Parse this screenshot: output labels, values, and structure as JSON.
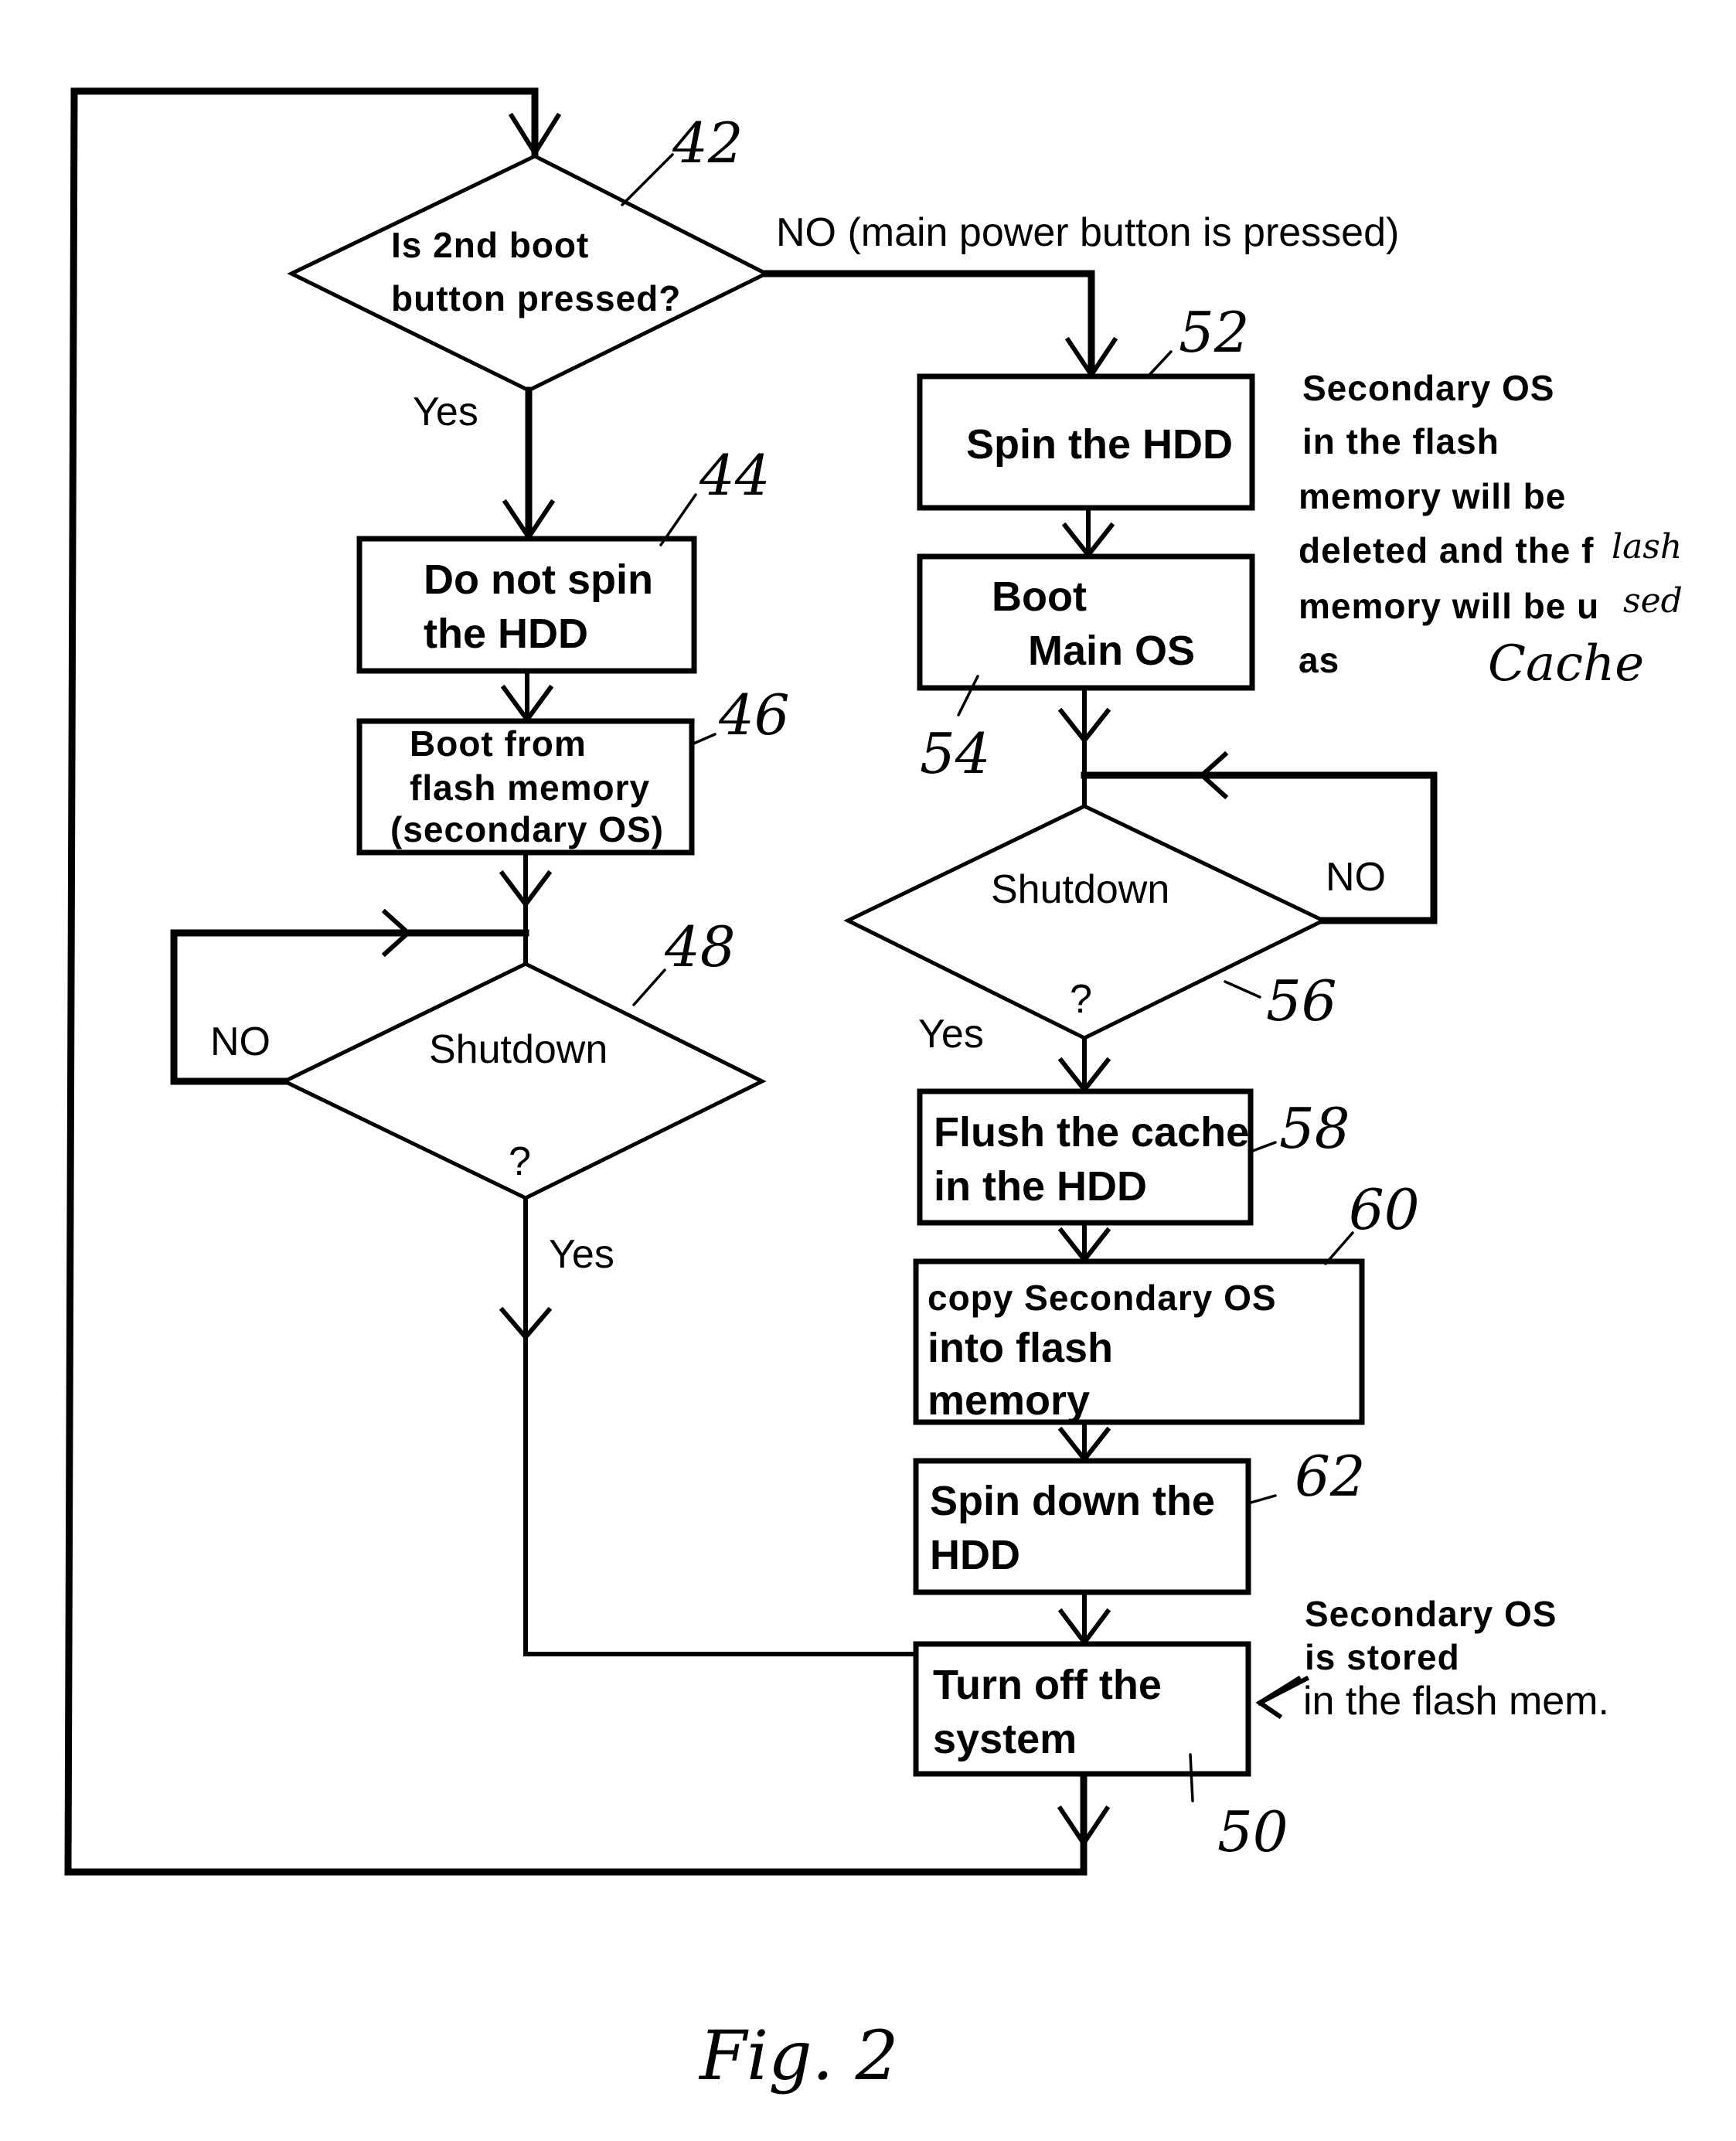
{
  "figure": {
    "caption": "Fig. 2"
  },
  "nodes": {
    "n42": {
      "ref": "42",
      "type": "decision",
      "lines": [
        "Is  2nd boot",
        "button pressed?"
      ]
    },
    "n44": {
      "ref": "44",
      "type": "process",
      "lines": [
        "Do not spin",
        "the HDD"
      ]
    },
    "n46": {
      "ref": "46",
      "type": "process",
      "lines": [
        "Boot from",
        "flash memory",
        "(secondary OS)"
      ]
    },
    "n48": {
      "ref": "48",
      "type": "decision",
      "lines": [
        "Shutdown",
        "?"
      ]
    },
    "n52": {
      "ref": "52",
      "type": "process",
      "lines": [
        "Spin the HDD"
      ]
    },
    "n54": {
      "ref": "54",
      "type": "process",
      "lines": [
        "Boot",
        "Main OS"
      ]
    },
    "n56": {
      "ref": "56",
      "type": "decision",
      "lines": [
        "Shutdown",
        "?"
      ]
    },
    "n58": {
      "ref": "58",
      "type": "process",
      "lines": [
        "Flush the cache",
        "in the HDD"
      ]
    },
    "n60": {
      "ref": "60",
      "type": "process",
      "lines": [
        "copy  Secondary OS",
        "into flash",
        "memory"
      ]
    },
    "n62": {
      "ref": "62",
      "type": "process",
      "lines": [
        "Spin down the",
        "HDD"
      ]
    },
    "n50": {
      "ref": "50",
      "type": "process",
      "lines": [
        "Turn off the",
        "system"
      ]
    }
  },
  "edge_labels": {
    "n42_no": "NO (main power button is pressed)",
    "n42_yes": "Yes",
    "n48_no": "NO",
    "n48_yes": "Yes",
    "n56_no": "NO",
    "n56_yes": "Yes"
  },
  "annotations": {
    "flash_cache_note": {
      "lines": [
        "Secondary OS",
        "in the flash",
        "memory will be",
        "deleted and the f",
        "memory will be u",
        "as"
      ],
      "handwritten": [
        "lash",
        "sed",
        "Cache"
      ]
    },
    "stored_note": {
      "lines": [
        "Secondary OS",
        "is stored",
        "in the flash mem."
      ]
    }
  }
}
